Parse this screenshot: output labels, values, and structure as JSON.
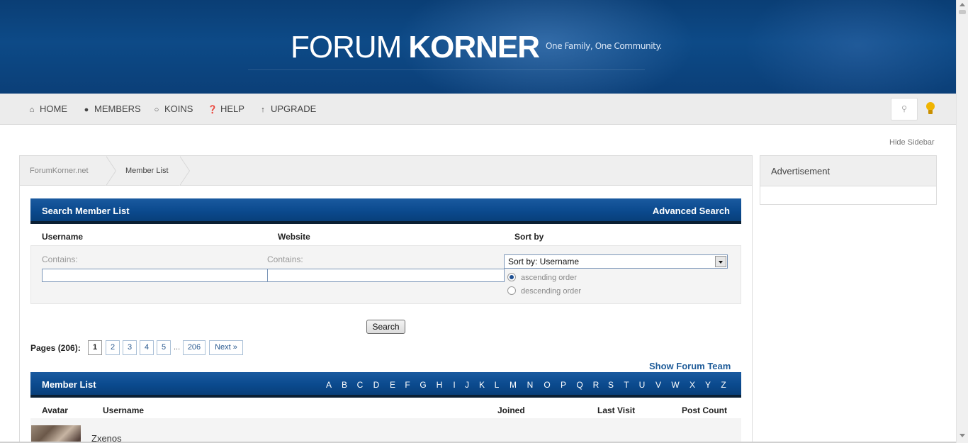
{
  "header": {
    "logo_thin": "FORUM",
    "logo_bold": "KORNER",
    "tagline": "One Family, One Community."
  },
  "nav": {
    "items": [
      {
        "label": "HOME",
        "icon": "home-icon"
      },
      {
        "label": "MEMBERS",
        "icon": "users-icon"
      },
      {
        "label": "KOINS",
        "icon": "circle-icon"
      },
      {
        "label": "HELP",
        "icon": "question-icon"
      },
      {
        "label": "UPGRADE",
        "icon": "arrow-up-icon"
      }
    ],
    "search_icon": "search-icon",
    "bulb_icon": "lightbulb-icon",
    "bulb_color": "#f0b400"
  },
  "hide_sidebar": "Hide Sidebar",
  "breadcrumb": [
    "ForumKorner.net",
    "Member List"
  ],
  "search_panel": {
    "title": "Search Member List",
    "advanced": "Advanced Search",
    "col_username": "Username",
    "col_website": "Website",
    "col_sort": "Sort by",
    "contains_1": "Contains:",
    "contains_2": "Contains:",
    "username_value": "",
    "website_value": "",
    "sort_selected": "Sort by: Username",
    "radio_asc": "ascending order",
    "radio_desc": "descending order",
    "search_button": "Search"
  },
  "pagination": {
    "label": "Pages (206):",
    "pages": [
      "1",
      "2",
      "3",
      "4",
      "5"
    ],
    "ellipsis": "...",
    "last": "206",
    "next": "Next »"
  },
  "show_forum_team": "Show Forum Team",
  "member_list": {
    "title": "Member List",
    "letters": [
      "A",
      "B",
      "C",
      "D",
      "E",
      "F",
      "G",
      "H",
      "I",
      "J",
      "K",
      "L",
      "M",
      "N",
      "O",
      "P",
      "Q",
      "R",
      "S",
      "T",
      "U",
      "V",
      "W",
      "X",
      "Y",
      "Z"
    ],
    "columns": {
      "avatar": "Avatar",
      "username": "Username",
      "joined": "Joined",
      "last_visit": "Last Visit",
      "post_count": "Post Count"
    },
    "rows": [
      {
        "username": "Zxenos"
      }
    ]
  },
  "sidebar": {
    "title": "Advertisement"
  },
  "colors": {
    "header_blue": "#0d4a87",
    "bar_blue": "#0b4a8e",
    "link_blue": "#1f5c99"
  }
}
